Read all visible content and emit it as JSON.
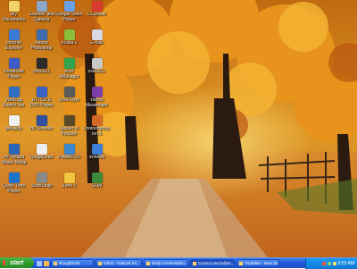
{
  "desktop": {
    "icons": [
      {
        "label": "My Documents",
        "color": "#f2d36a"
      },
      {
        "label": "Scanner and Camera Wizard",
        "color": "#8da7c7"
      },
      {
        "label": "Google Video Player",
        "color": "#6aa0e6"
      },
      {
        "label": "CCleaner",
        "color": "#d93c2e"
      },
      {
        "label": "Internet Explorer",
        "color": "#3a7bd5"
      },
      {
        "label": "Adobe Photoshop 7.0",
        "color": "#3d6db0"
      },
      {
        "label": "nVidia 2",
        "color": "#8bbf3a"
      },
      {
        "label": "E-mail",
        "color": "#d9d9e6"
      },
      {
        "label": "Broadcast Player",
        "color": "#3b5cc4"
      },
      {
        "label": "Net0921",
        "color": "#2b2b2b"
      },
      {
        "label": "Acer eManager",
        "color": "#31a34a"
      },
      {
        "label": "lisa0821",
        "color": "#c9c9c9"
      },
      {
        "label": "WebLog Expert Lite",
        "color": "#2f6fc2"
      },
      {
        "label": "RTI CD & DVD Player",
        "color": "#3b63c6"
      },
      {
        "label": "WMPlayer",
        "color": "#5b5b5b"
      },
      {
        "label": "Yahoo! Messenger",
        "color": "#7b3fa8"
      },
      {
        "label": "pexalize",
        "color": "#f0f0f0"
      },
      {
        "label": "HP Director",
        "color": "#2f4fa1"
      },
      {
        "label": "Soldier of Fortune",
        "color": "#5a4a2a"
      },
      {
        "label": "PhotoImpression 5",
        "color": "#d46a2a"
      },
      {
        "label": "HP Instant Share Setup",
        "color": "#2a66b5"
      },
      {
        "label": "RoughDraft",
        "color": "#ededed"
      },
      {
        "label": "PowerDVD",
        "color": "#3a87d0"
      },
      {
        "label": "WinAce",
        "color": "#3f7fd9"
      },
      {
        "label": "Quick Time Player",
        "color": "#1c74c9"
      },
      {
        "label": "ScanSnap",
        "color": "#8a8a8a"
      },
      {
        "label": "Zone 2",
        "color": "#f0c43c"
      },
      {
        "label": "GOM",
        "color": "#3b8a3b"
      }
    ]
  },
  "taskbar": {
    "start_label": "start",
    "tasks": [
      {
        "label": "RoughDraft"
      },
      {
        "label": "Inbox - Outlook Ex..."
      },
      {
        "label": "Daily conversation..."
      },
      {
        "label": "Comics and Editor..."
      },
      {
        "label": "TradeMe - New Ze..."
      }
    ],
    "clock": "9:55 AM"
  },
  "colors": {
    "taskbar": "#245ad8",
    "start": "#2f9a2c",
    "tray": "#0f78d6"
  }
}
